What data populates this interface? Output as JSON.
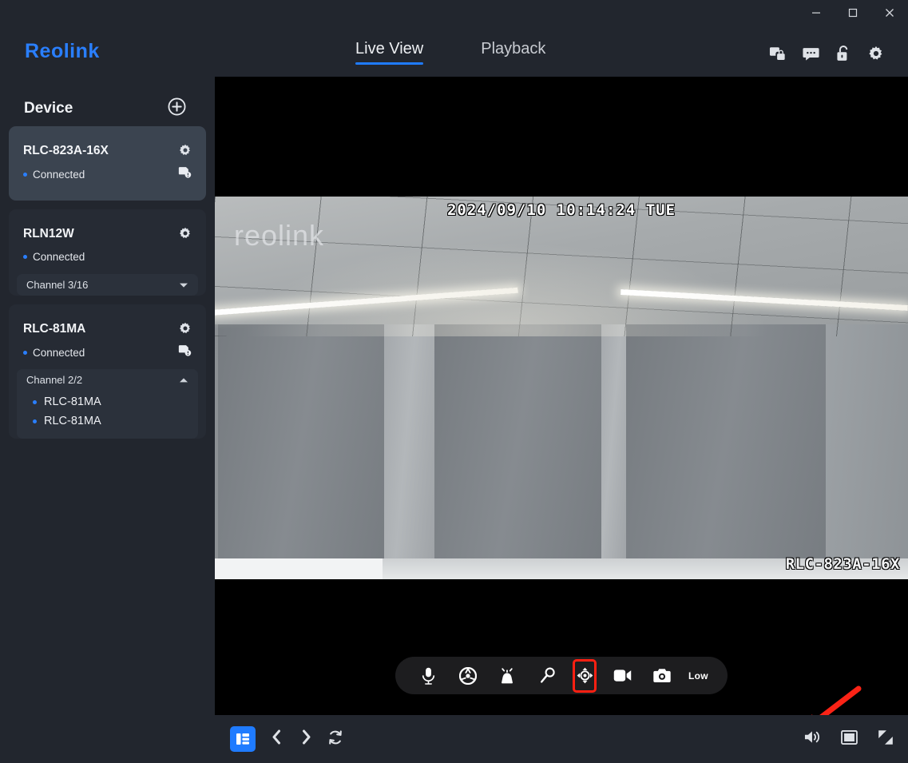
{
  "window": {
    "minimize_label": "Minimize",
    "maximize_label": "Maximize",
    "close_label": "Close"
  },
  "header": {
    "logo": "Reolink",
    "tabs": [
      {
        "label": "Live View",
        "active": true
      },
      {
        "label": "Playback",
        "active": false
      }
    ],
    "icons": [
      {
        "name": "device-lock-icon",
        "title": "Devices"
      },
      {
        "name": "chat-bubble-icon",
        "title": "Feedback"
      },
      {
        "name": "unlock-padlock-icon",
        "title": "Lock"
      },
      {
        "name": "gear-icon",
        "title": "Settings"
      }
    ]
  },
  "sidebar": {
    "title": "Device",
    "add_device_label": "+",
    "devices": [
      {
        "name": "RLC-823A-16X",
        "status": "Connected",
        "selected": true,
        "has_channel": false,
        "channel_label": "",
        "channel_open": false,
        "channels": []
      },
      {
        "name": "RLN12W",
        "status": "Connected",
        "selected": false,
        "has_channel": true,
        "channel_label": "Channel 3/16",
        "channel_open": false,
        "channels": []
      },
      {
        "name": "RLC-81MA",
        "status": "Connected",
        "selected": false,
        "has_channel": true,
        "channel_label": "Channel 2/2",
        "channel_open": true,
        "channels": [
          "RLC-81MA",
          "RLC-81MA"
        ]
      }
    ]
  },
  "video": {
    "osd_timestamp": "2024/09/10 10:14:24 TUE",
    "osd_camera_name": "RLC-823A-16X",
    "watermark": "reolink"
  },
  "toolbar": {
    "buttons": [
      {
        "name": "microphone-icon",
        "label": "Two-way talk",
        "highlighted": false
      },
      {
        "name": "color-wheel-icon",
        "label": "Image settings",
        "highlighted": false
      },
      {
        "name": "siren-icon",
        "label": "Siren",
        "highlighted": false
      },
      {
        "name": "spotlight-icon",
        "label": "Spotlight",
        "highlighted": false
      },
      {
        "name": "ptz-control-icon",
        "label": "PTZ",
        "highlighted": true
      },
      {
        "name": "record-video-icon",
        "label": "Record",
        "highlighted": false
      },
      {
        "name": "snapshot-camera-icon",
        "label": "Snapshot",
        "highlighted": false
      }
    ],
    "quality_label": "Low"
  },
  "bottombar": {
    "layout_label": "Layout",
    "prev_label": "Previous",
    "next_label": "Next",
    "refresh_label": "Refresh",
    "volume_label": "Volume",
    "screen_label": "Screen mode",
    "fullscreen_label": "Fullscreen"
  },
  "colors": {
    "accent_blue": "#1f7bff",
    "logo_blue": "#2a7fff",
    "panel_bg": "#22262e",
    "card_bg": "#262b34",
    "card_selected_bg": "#3b4450",
    "highlight_red": "#ff2012"
  }
}
